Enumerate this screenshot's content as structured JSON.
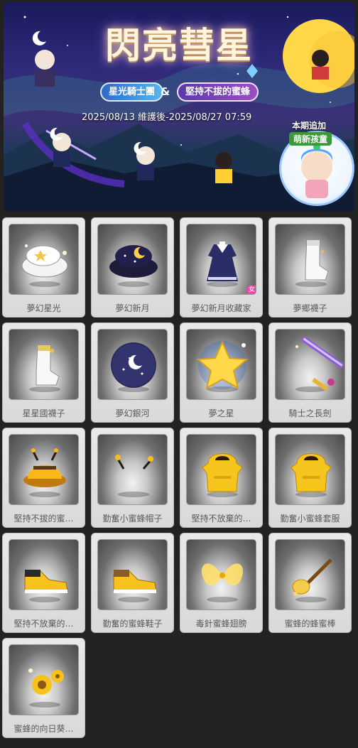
{
  "banner": {
    "title": "閃亮彗星",
    "subtitle_left": "星光騎士團",
    "subtitle_amp": "&",
    "subtitle_right": "堅持不拔的蜜蜂",
    "date_range": "2025/08/13 維護後-2025/08/27 07:59",
    "addon_title": "本期追加",
    "addon_subtitle": "萌新孩童"
  },
  "items": [
    {
      "label": "夢幻星光",
      "icon": "white-star-hat-icon"
    },
    {
      "label": "夢幻新月",
      "icon": "dark-moon-hat-icon"
    },
    {
      "label": "夢幻新月收藏家",
      "icon": "navy-dress-icon",
      "badge": "女"
    },
    {
      "label": "夢鄉襪子",
      "icon": "white-sock-icon"
    },
    {
      "label": "星星國襪子",
      "icon": "white-sock-gold-icon"
    },
    {
      "label": "夢幻銀河",
      "icon": "galaxy-orb-icon"
    },
    {
      "label": "夢之星",
      "icon": "yellow-star-icon"
    },
    {
      "label": "騎士之長劍",
      "icon": "purple-sword-icon"
    },
    {
      "label": "堅持不拔的蜜…",
      "icon": "bee-hat-icon"
    },
    {
      "label": "勤奮小蜜蜂帽子",
      "icon": "bee-antenna-icon"
    },
    {
      "label": "堅持不放棄的…",
      "icon": "yellow-hoodie-icon"
    },
    {
      "label": "勤奮小蜜蜂套服",
      "icon": "yellow-hoodie-icon"
    },
    {
      "label": "堅持不放棄的…",
      "icon": "yellow-shoe-icon"
    },
    {
      "label": "勤奮的蜜蜂鞋子",
      "icon": "yellow-shoe-brown-icon"
    },
    {
      "label": "毒針蜜蜂翅膀",
      "icon": "golden-wings-icon"
    },
    {
      "label": "蜜蜂的蜂蜜棒",
      "icon": "honey-dipper-icon"
    },
    {
      "label": "蜜蜂的向日葵…",
      "icon": "sunflower-icon"
    }
  ]
}
